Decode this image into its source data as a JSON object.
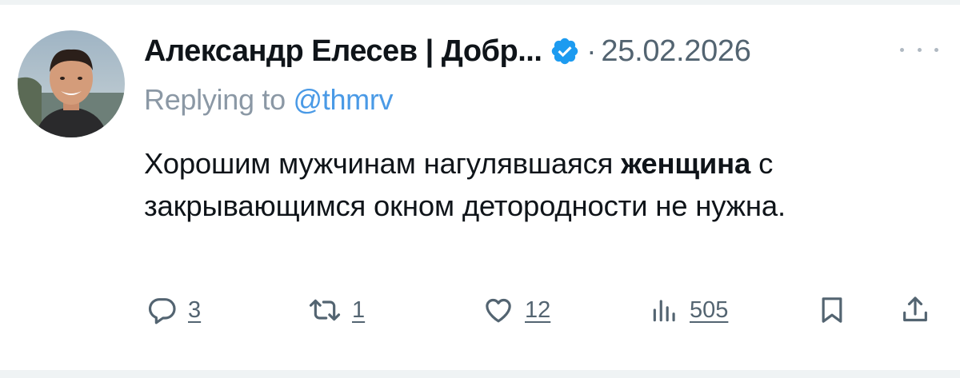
{
  "tweet": {
    "author_name": "Александр Елесев | Добр...",
    "separator": "·",
    "timestamp": "25.02.2026",
    "replying_prefix": "Replying to ",
    "replying_handle": "@thmrv",
    "text_part1": "Хорошим мужчинам нагулявшаяся ",
    "text_bold": "женщина",
    "text_part2": " с закрывающимся окном детородности не нужна."
  },
  "actions": {
    "reply_count": "3",
    "retweet_count": "1",
    "like_count": "12",
    "views_count": "505"
  },
  "icons": {
    "avatar": "avatar-photo",
    "verified": "verified-badge-icon",
    "more": "more-options-icon",
    "reply": "reply-icon",
    "retweet": "retweet-icon",
    "like": "heart-icon",
    "views": "views-bar-chart-icon",
    "bookmark": "bookmark-icon",
    "share": "share-icon"
  },
  "colors": {
    "text": "#0f1419",
    "secondary": "#536471",
    "muted": "#8b98a5",
    "link": "#4a9ae6",
    "verified": "#1d9bf0"
  }
}
